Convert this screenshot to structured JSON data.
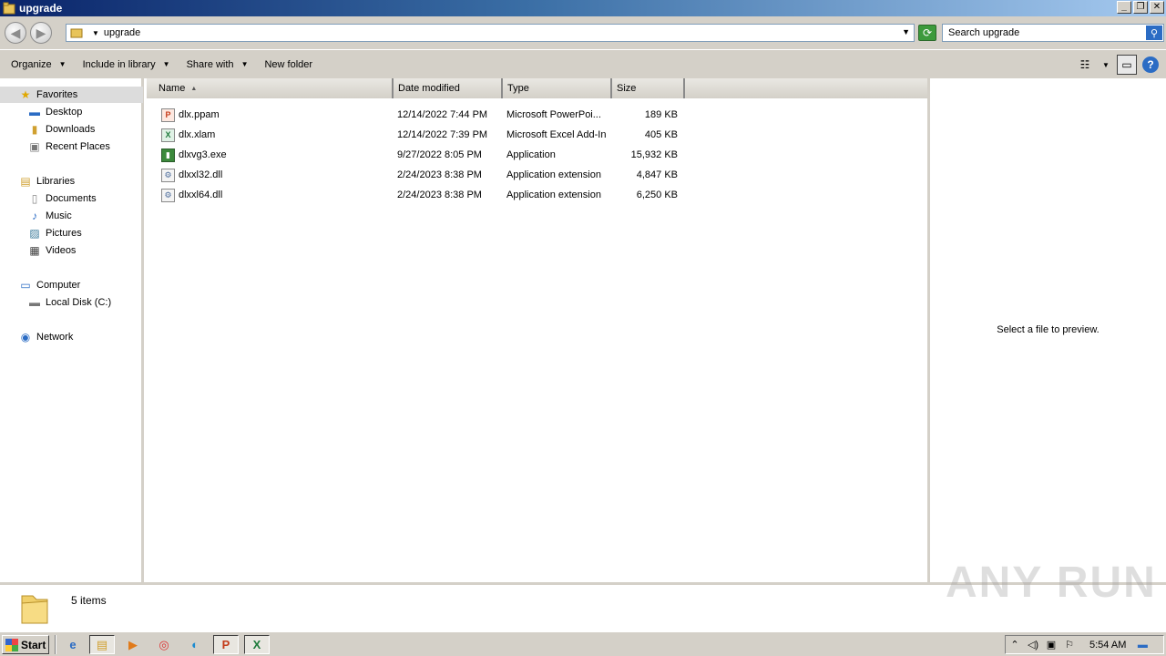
{
  "window": {
    "title": "upgrade"
  },
  "address": {
    "path": "upgrade"
  },
  "search": {
    "placeholder": "Search upgrade"
  },
  "toolbar": {
    "organize": "Organize",
    "include_in_library": "Include in library",
    "share_with": "Share with",
    "new_folder": "New folder"
  },
  "nav": {
    "favorites": "Favorites",
    "desktop": "Desktop",
    "downloads": "Downloads",
    "recent_places": "Recent Places",
    "libraries": "Libraries",
    "documents": "Documents",
    "music": "Music",
    "pictures": "Pictures",
    "videos": "Videos",
    "computer": "Computer",
    "local_disk": "Local Disk (C:)",
    "network": "Network"
  },
  "columns": {
    "name": "Name",
    "date": "Date modified",
    "type": "Type",
    "size": "Size"
  },
  "files": [
    {
      "name": "dlx.ppam",
      "date": "12/14/2022 7:44 PM",
      "type": "Microsoft PowerPoi...",
      "size": "189 KB",
      "icon": "powerpoint-icon"
    },
    {
      "name": "dlx.xlam",
      "date": "12/14/2022 7:39 PM",
      "type": "Microsoft Excel Add-In",
      "size": "405 KB",
      "icon": "excel-icon"
    },
    {
      "name": "dlxvg3.exe",
      "date": "9/27/2022 8:05 PM",
      "type": "Application",
      "size": "15,932 KB",
      "icon": "exe-icon"
    },
    {
      "name": "dlxxl32.dll",
      "date": "2/24/2023 8:38 PM",
      "type": "Application extension",
      "size": "4,847 KB",
      "icon": "dll-icon"
    },
    {
      "name": "dlxxl64.dll",
      "date": "2/24/2023 8:38 PM",
      "type": "Application extension",
      "size": "6,250 KB",
      "icon": "dll-icon"
    }
  ],
  "preview": {
    "message": "Select a file to preview."
  },
  "details": {
    "count": "5 items"
  },
  "watermark": "ANY RUN",
  "taskbar": {
    "start": "Start",
    "clock": "5:54 AM"
  }
}
